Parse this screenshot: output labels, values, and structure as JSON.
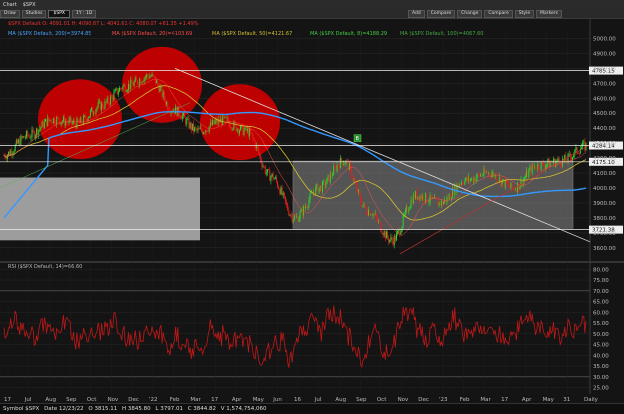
{
  "window": {
    "tabs": [
      "Chart",
      "$SPX"
    ],
    "toolbar": {
      "symbol": "$SPX",
      "time_button": "1Y : 1D",
      "add_label": "Add",
      "compare_label": "Compare",
      "change_label": "Change",
      "markers_label": "Markers",
      "menu_items": [
        "Draw",
        "Studies",
        "Compare",
        "Style"
      ]
    }
  },
  "legend": {
    "price": "$SPX Default  O: 4091.01  H: 4090.67  L: 4041.61  C: 4080.07  +61.35  +1.49%",
    "ma200": "MA ($SPX Default, 200)=3974.85",
    "ma_red": "MA ($SPX Default, 20)=4103.69",
    "ma50": "MA ($SPX Default, 50)=4121.67",
    "ma8": "MA ($SPX Default, 8)=4188.29",
    "ma100": "MA ($SPX Default, 100)=4067.60",
    "rsi": "RSI ($SPX Default, 14)=66.60"
  },
  "colors": {
    "background": "#141414",
    "candle_up": "#2bd52b",
    "candle_down": "#e02020",
    "ma200": "#3399ff",
    "ma50": "#d4c030",
    "rsi": "#c01818",
    "circle": "#cc0000"
  },
  "price_axis": {
    "ticks": [
      "5000.00",
      "4900.00",
      "4800.00",
      "4700.00",
      "4600.00",
      "4500.00",
      "4400.00",
      "4300.00",
      "4200.00",
      "4100.00",
      "4000.00",
      "3900.00",
      "3800.00",
      "3700.00",
      "3600.00"
    ],
    "levels": [
      {
        "label": "4785.15",
        "value": 4785.15
      },
      {
        "label": "4284.14",
        "value": 4284.14
      },
      {
        "label": "4175.10",
        "value": 4175.1
      },
      {
        "label": "3721.38",
        "value": 3721.38
      }
    ],
    "min": 3525,
    "max": 5050
  },
  "rsi_axis": {
    "ticks": [
      "80.00",
      "75.00",
      "70.00",
      "65.00",
      "60.00",
      "55.00",
      "50.00",
      "45.00",
      "40.00",
      "35.00",
      "30.00",
      "25.00"
    ],
    "min": 22,
    "max": 82
  },
  "time_axis": {
    "labels": [
      "17",
      "Jul",
      "Aug",
      "Sep",
      "Oct",
      "Nov",
      "Dec",
      "'22",
      "Feb",
      "Mar",
      "17",
      "Apr",
      "May",
      "Jun",
      "16",
      "Jul",
      "Aug",
      "Sep",
      "Oct",
      "Nov",
      "Dec",
      "'23",
      "Feb",
      "Mar",
      "17",
      "Apr",
      "May",
      "31",
      "Daily"
    ]
  },
  "annotations": {
    "marker_label": "B"
  },
  "chart_data": {
    "type": "line",
    "x": [
      "2021-06",
      "2021-07",
      "2021-08",
      "2021-09",
      "2021-10",
      "2021-11",
      "2021-12",
      "2022-01",
      "2022-02",
      "2022-03",
      "2022-04",
      "2022-05",
      "2022-06",
      "2022-07",
      "2022-08",
      "2022-09",
      "2022-10",
      "2022-11",
      "2022-12",
      "2023-01",
      "2023-02",
      "2023-03",
      "2023-04",
      "2023-05",
      "2023-06"
    ],
    "series": [
      {
        "values": [
          4220,
          4350,
          4460,
          4430,
          4550,
          4680,
          4750,
          4520,
          4380,
          4450,
          4380,
          4080,
          3800,
          4000,
          4180,
          3850,
          3650,
          3950,
          3900,
          4050,
          4100,
          4000,
          4150,
          4180,
          4280
        ]
      }
    ]
  },
  "status": {
    "symbol": "Symbol $SPX",
    "date": "Date 12/23/22",
    "open": "O 3815.11",
    "high": "H 3845.80",
    "low": "L 3797.01",
    "close": "C 3844.82",
    "volume": "V 1,574,754,060"
  }
}
